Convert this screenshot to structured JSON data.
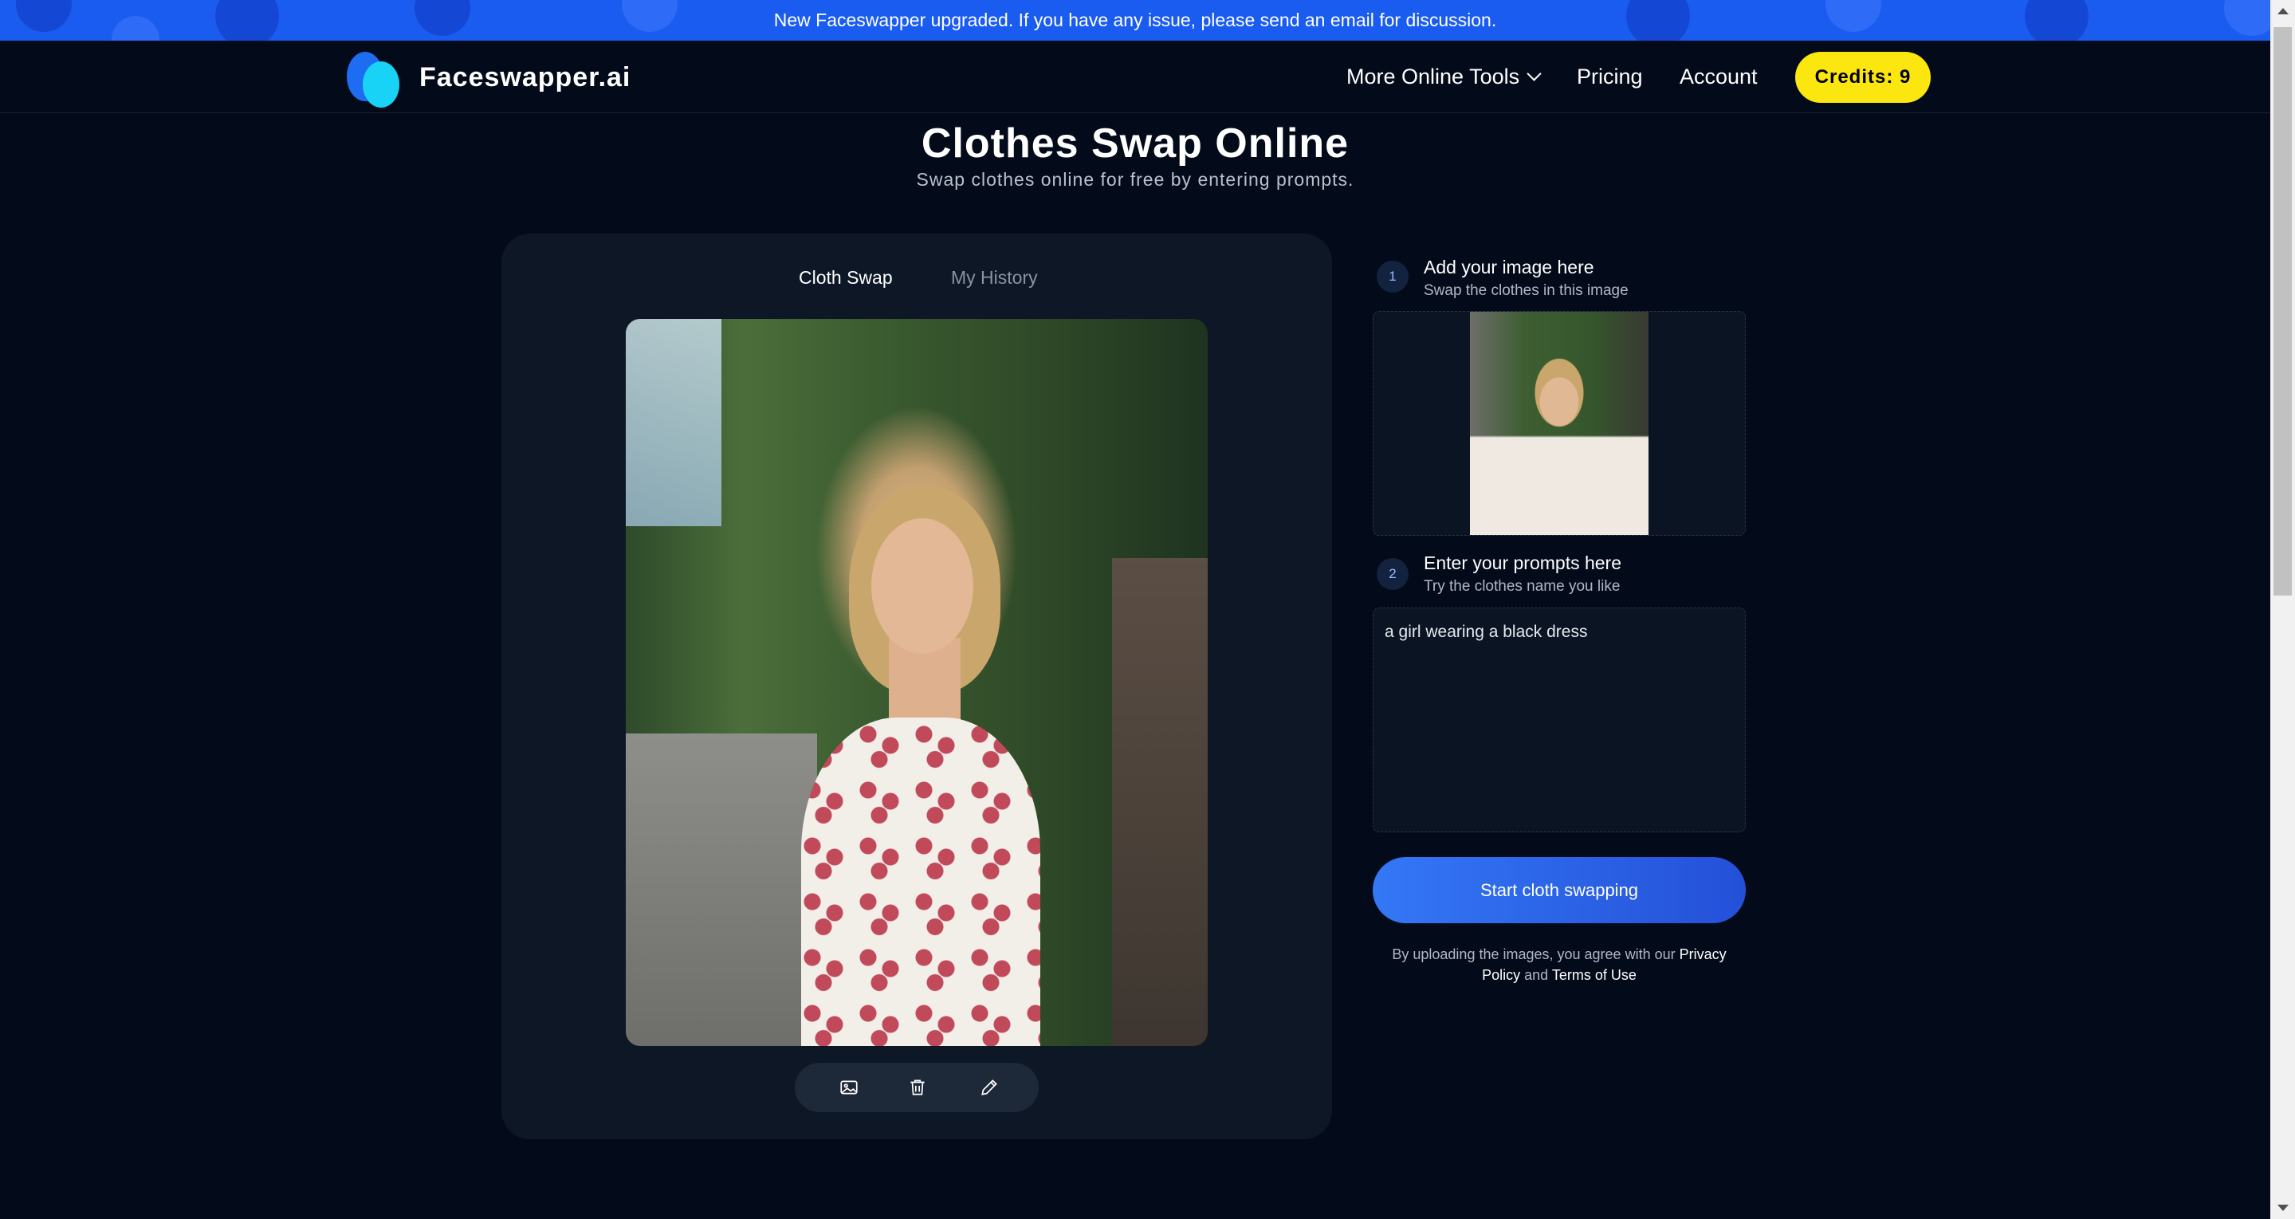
{
  "banner": {
    "text": "New Faceswapper upgraded. If you have any issue, please send an email for discussion."
  },
  "header": {
    "brand": "Faceswapper.ai",
    "nav": {
      "tools": "More Online Tools",
      "pricing": "Pricing",
      "account": "Account"
    },
    "credits": "Credits: 9"
  },
  "page": {
    "title": "Clothes Swap Online",
    "subtitle": "Swap clothes online for free by entering prompts."
  },
  "tabs": [
    "Cloth Swap",
    "My History"
  ],
  "toolbar": {
    "icons": [
      "image-icon",
      "trash-icon",
      "pencil-icon"
    ]
  },
  "steps": [
    {
      "num": "1",
      "title": "Add your image here",
      "sub": "Swap the clothes in this image"
    },
    {
      "num": "2",
      "title": "Enter your prompts here",
      "sub": "Try the clothes name you like"
    }
  ],
  "prompt": {
    "value": "a girl wearing a black dress"
  },
  "start_button": "Start cloth swapping",
  "legal": {
    "prefix": "By uploading the images, you agree with our",
    "privacy": "Privacy Policy",
    "and": "and",
    "terms": "Terms of Use"
  },
  "colors": {
    "banner": "#1a5cf0",
    "background": "#030b1a",
    "credits": "#fbe610",
    "accent": "#3478f6"
  }
}
